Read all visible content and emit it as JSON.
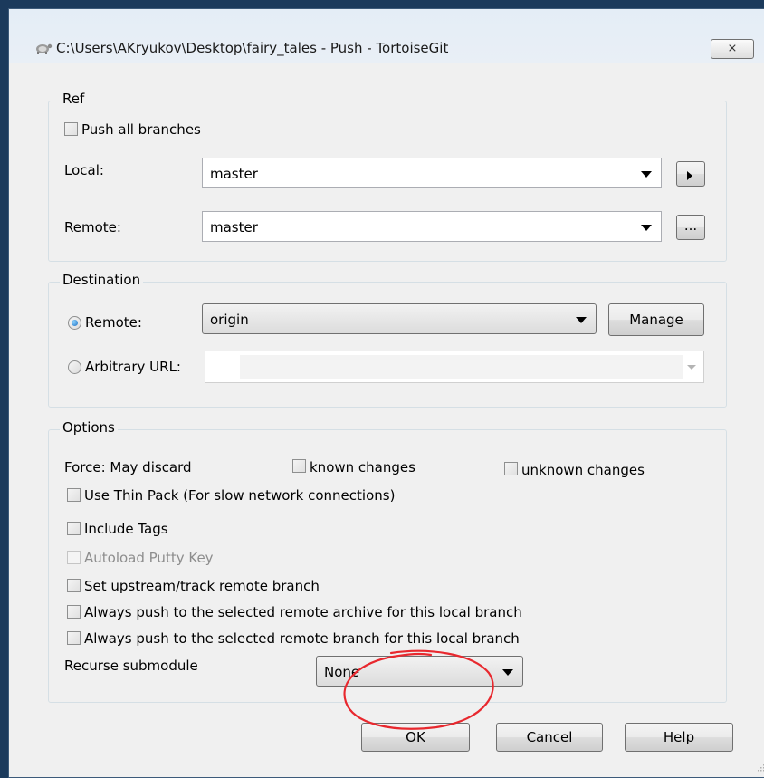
{
  "window": {
    "title": "C:\\Users\\AKryukov\\Desktop\\fairy_tales - Push - TortoiseGit",
    "close_glyph": "⨯",
    "app_icon": "tortoisegit-icon"
  },
  "ref": {
    "legend": "Ref",
    "push_all_branches": "Push all branches",
    "local_label": "Local:",
    "local_value": "master",
    "remote_label": "Remote:",
    "remote_value": "master",
    "browse_label": "..."
  },
  "destination": {
    "legend": "Destination",
    "remote_label": "Remote:",
    "remote_value": "origin",
    "manage_label": "Manage",
    "arbitrary_label": "Arbitrary URL:",
    "arbitrary_value": ""
  },
  "options": {
    "legend": "Options",
    "force_label": "Force: May discard",
    "known_changes": "known changes",
    "unknown_changes": "unknown changes",
    "thin_pack": "Use Thin Pack (For slow network connections)",
    "include_tags": "Include Tags",
    "autoload_putty": "Autoload Putty Key",
    "set_upstream": "Set upstream/track remote branch",
    "always_archive": "Always push to the selected remote archive for this local branch",
    "always_branch": "Always push to the selected remote branch for this local branch",
    "recurse_label": "Recurse submodule",
    "recurse_value": "None"
  },
  "buttons": {
    "ok": "OK",
    "cancel": "Cancel",
    "help": "Help"
  },
  "annotation": {
    "circle_color": "#e8282e"
  }
}
